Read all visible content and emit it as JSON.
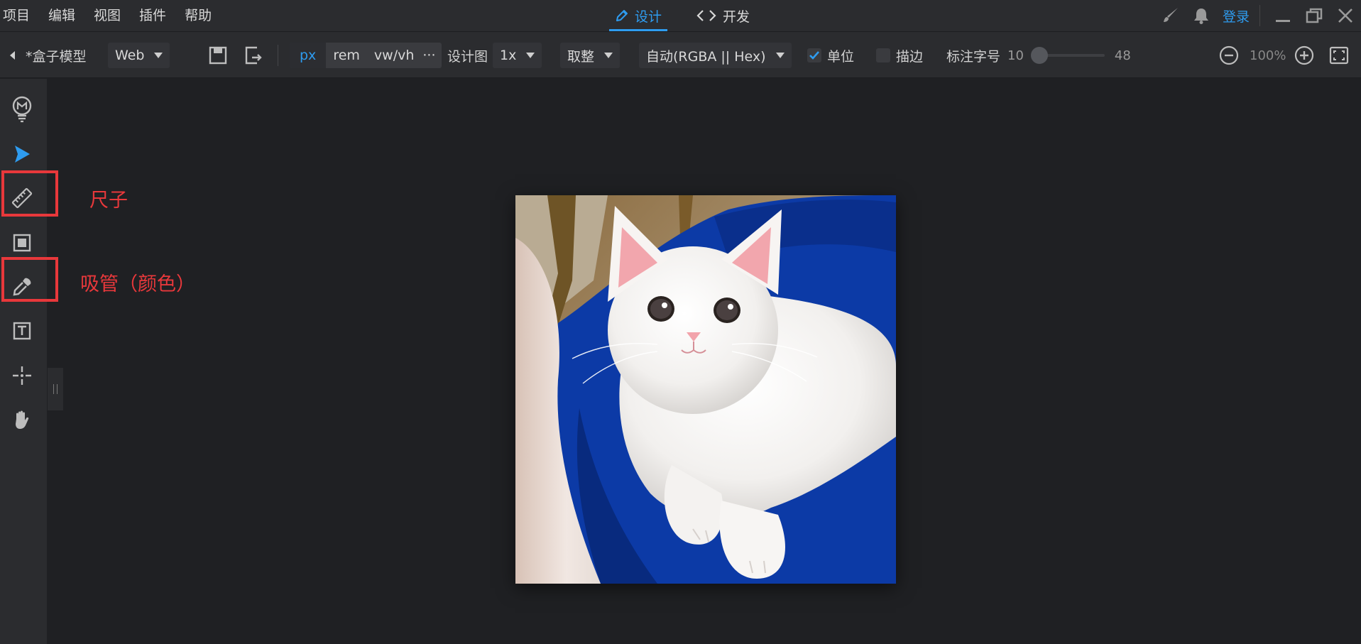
{
  "menu": {
    "items": [
      "项目",
      "编辑",
      "视图",
      "插件",
      "帮助"
    ]
  },
  "modes": {
    "design": "设计",
    "develop": "开发"
  },
  "account": {
    "login": "登录"
  },
  "toolbar": {
    "title": "*盒子模型",
    "platform": "Web",
    "units": [
      "px",
      "rem",
      "vw/vh",
      "···"
    ],
    "active_unit": "px",
    "design_label": "设计图",
    "design_scale": "1x",
    "rounding": "取整",
    "color_format": "自动(RGBA || Hex)",
    "unit_label": "单位",
    "unit_checked": true,
    "stroke_label": "描边",
    "stroke_checked": false,
    "font_label": "标注字号",
    "font_min": "10",
    "font_max": "48",
    "zoom": "100%"
  },
  "tools": [
    "logo-icon",
    "select-icon",
    "ruler-icon",
    "artboard-icon",
    "eyedropper-icon",
    "text-icon",
    "crosshair-icon",
    "hand-icon"
  ],
  "annotations": {
    "ruler": "尺子",
    "eyedropper": "吸管（颜色）"
  },
  "colors": {
    "accent": "#2e9cf0",
    "highlight": "#e8383b",
    "background": "#1f2023",
    "panel": "#2b2c2f"
  }
}
